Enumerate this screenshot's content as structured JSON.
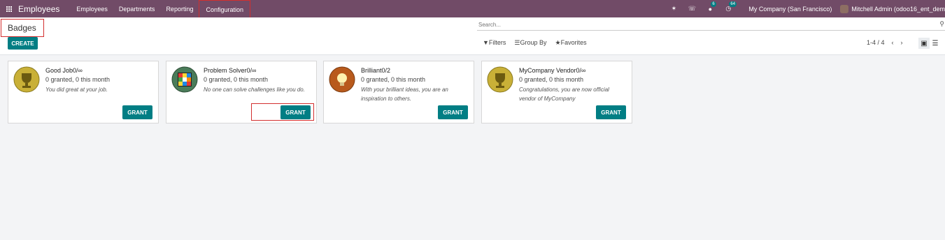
{
  "navbar": {
    "app_name": "Employees",
    "menu": [
      "Employees",
      "Departments",
      "Reporting",
      "Configuration"
    ],
    "chat_count": "6",
    "activity_count": "64",
    "company": "My Company (San Francisco)",
    "user": "Mitchell Admin (odoo16_ent_dem"
  },
  "breadcrumb": "Badges",
  "create_label": "CREATE",
  "search": {
    "placeholder": "Search..."
  },
  "filters": [
    "Filters",
    "Group By",
    "Favorites"
  ],
  "pager": "1-4 / 4",
  "badges": [
    {
      "name": "Good Job",
      "limit": "0/∞",
      "granted": "0 granted, 0 this month",
      "description": "You did great at your job.",
      "grant_label": "GRANT"
    },
    {
      "name": "Problem Solver",
      "limit": "0/∞",
      "granted": "0 granted, 0 this month",
      "description": "No one can solve challenges like you do.",
      "grant_label": "GRANT"
    },
    {
      "name": "Brilliant",
      "limit": "0/2",
      "granted": "0 granted, 0 this month",
      "description": "With your brilliant ideas, you are an inspiration to others.",
      "grant_label": "GRANT"
    },
    {
      "name": "MyCompany Vendor",
      "limit": "0/∞",
      "granted": "0 granted, 0 this month",
      "description": "Congratulations, you are now official vendor of MyCompany",
      "grant_label": "GRANT"
    }
  ],
  "colors": {
    "brand": "#714b67",
    "accent": "#017e84",
    "highlight": "#d32f2f"
  }
}
